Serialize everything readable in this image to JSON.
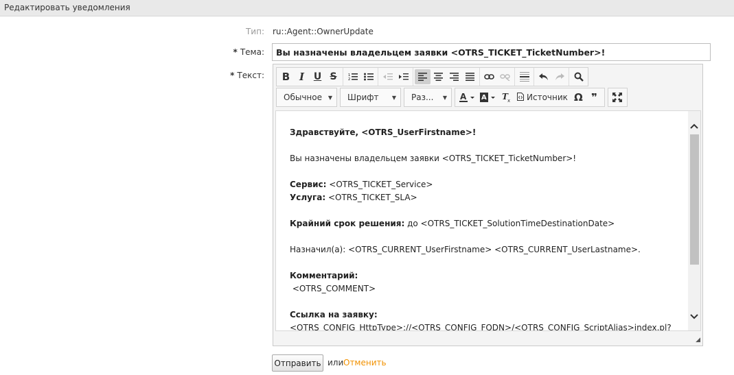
{
  "header": {
    "title": "Редактировать уведомления"
  },
  "form": {
    "type_label": "Тип:",
    "type_value": "ru::Agent::OwnerUpdate",
    "required_mark": "*",
    "subject_label": "Тема:",
    "subject_value": "Вы назначены владельцем заявки <OTRS_TICKET_TicketNumber>!",
    "text_label": "Текст:"
  },
  "toolbar": {
    "bold": "B",
    "italic": "I",
    "underline": "U",
    "strike": "S",
    "format": "Обычное",
    "font": "Шрифт",
    "size": "Раз...",
    "source": "Источник"
  },
  "body": {
    "greeting": "Здравствуйте, <OTRS_UserFirstname>!",
    "line1": "Вы назначены владельцем заявки <OTRS_TICKET_TicketNumber>!",
    "service_label": "Сервис:",
    "service_value": " <OTRS_TICKET_Service>",
    "sla_label": "Услуга:",
    "sla_value": " <OTRS_TICKET_SLA>",
    "deadline_label": "Крайний срок решения:",
    "deadline_value": " до <OTRS_TICKET_SolutionTimeDestinationDate>",
    "assigned": "Назначил(а): <OTRS_CURRENT_UserFirstname> <OTRS_CURRENT_UserLastname>.",
    "comment_label": "Комментарий:",
    "comment_value": " <OTRS_COMMENT>",
    "link_label": "Ссылка на заявку:",
    "link_value": "<OTRS_CONFIG_HttpType>://<OTRS_CONFIG_FQDN>/<OTRS_CONFIG_ScriptAlias>index.pl?"
  },
  "actions": {
    "submit": "Отправить",
    "or": "или",
    "cancel": "Отменить"
  }
}
